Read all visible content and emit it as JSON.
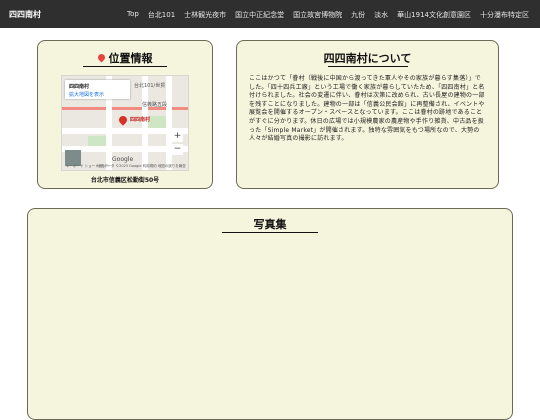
{
  "navbar": {
    "brand": "四四南村",
    "links": [
      "Top",
      "台北101",
      "士林観光夜市",
      "国立中正紀念堂",
      "国立故宮博物院",
      "九份",
      "淡水",
      "華山1914文化創意園区",
      "十分瀑布特定区"
    ]
  },
  "location": {
    "title": "位置情報",
    "map": {
      "box_title": "四四南村",
      "box_link": "拡大地図を表示",
      "place_label": "四四南村",
      "station_label": "台北101/世貿",
      "street_label": "信義路五段",
      "google": "Google",
      "attribution": "地図データ ©2023 Google 利用規約 地図の誤りを報告",
      "shortcut": "キーボード ショートカット",
      "zoom_in": "+",
      "zoom_out": "−"
    },
    "address": "台北市信義区松勤街50号"
  },
  "about": {
    "title": "四四南村について",
    "body": "ここはかつて「眷村（戦後に中国から渡ってきた軍人やその家族が暮らす集落）」でした。「四十四兵工廠」という工場で働く家族が暮らしていたため、「四四南村」と名付けられました。社会の変遷に伴い、眷村は次第に改められ、古い長屋の建物の一部を残すことになりました。建物の一部は「信義公民会館」に再整備され、イベントや展覧会を開催するオープン・スペースとなっています。ここは眷村の跡地であることがすぐに分かります。休日の広場では小規模農家の農産物や手作り雑貨、中古品を扱った「Simple Market」が開催されます。独特な雰囲気をもつ場所なので、大勢の人々が結婚写真の撮影に訪れます。"
  },
  "gallery": {
    "title": "写真集"
  },
  "colors": {
    "navbar_bg": "#2f2f2f",
    "card_bg": "#f5f4dc",
    "pin": "#e8443a"
  }
}
